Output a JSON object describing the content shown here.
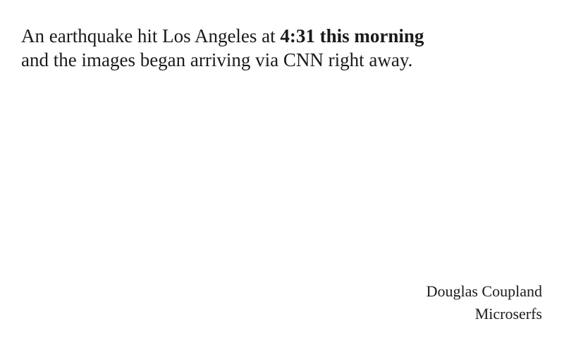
{
  "quote": {
    "line1_start": "An earthquake hit Los Angeles at ",
    "line1_emphasis": "4:31 this morning",
    "line2": "and the images began arriving via CNN right away."
  },
  "attribution": {
    "author": "Douglas Coupland",
    "work": "Microserfs"
  }
}
